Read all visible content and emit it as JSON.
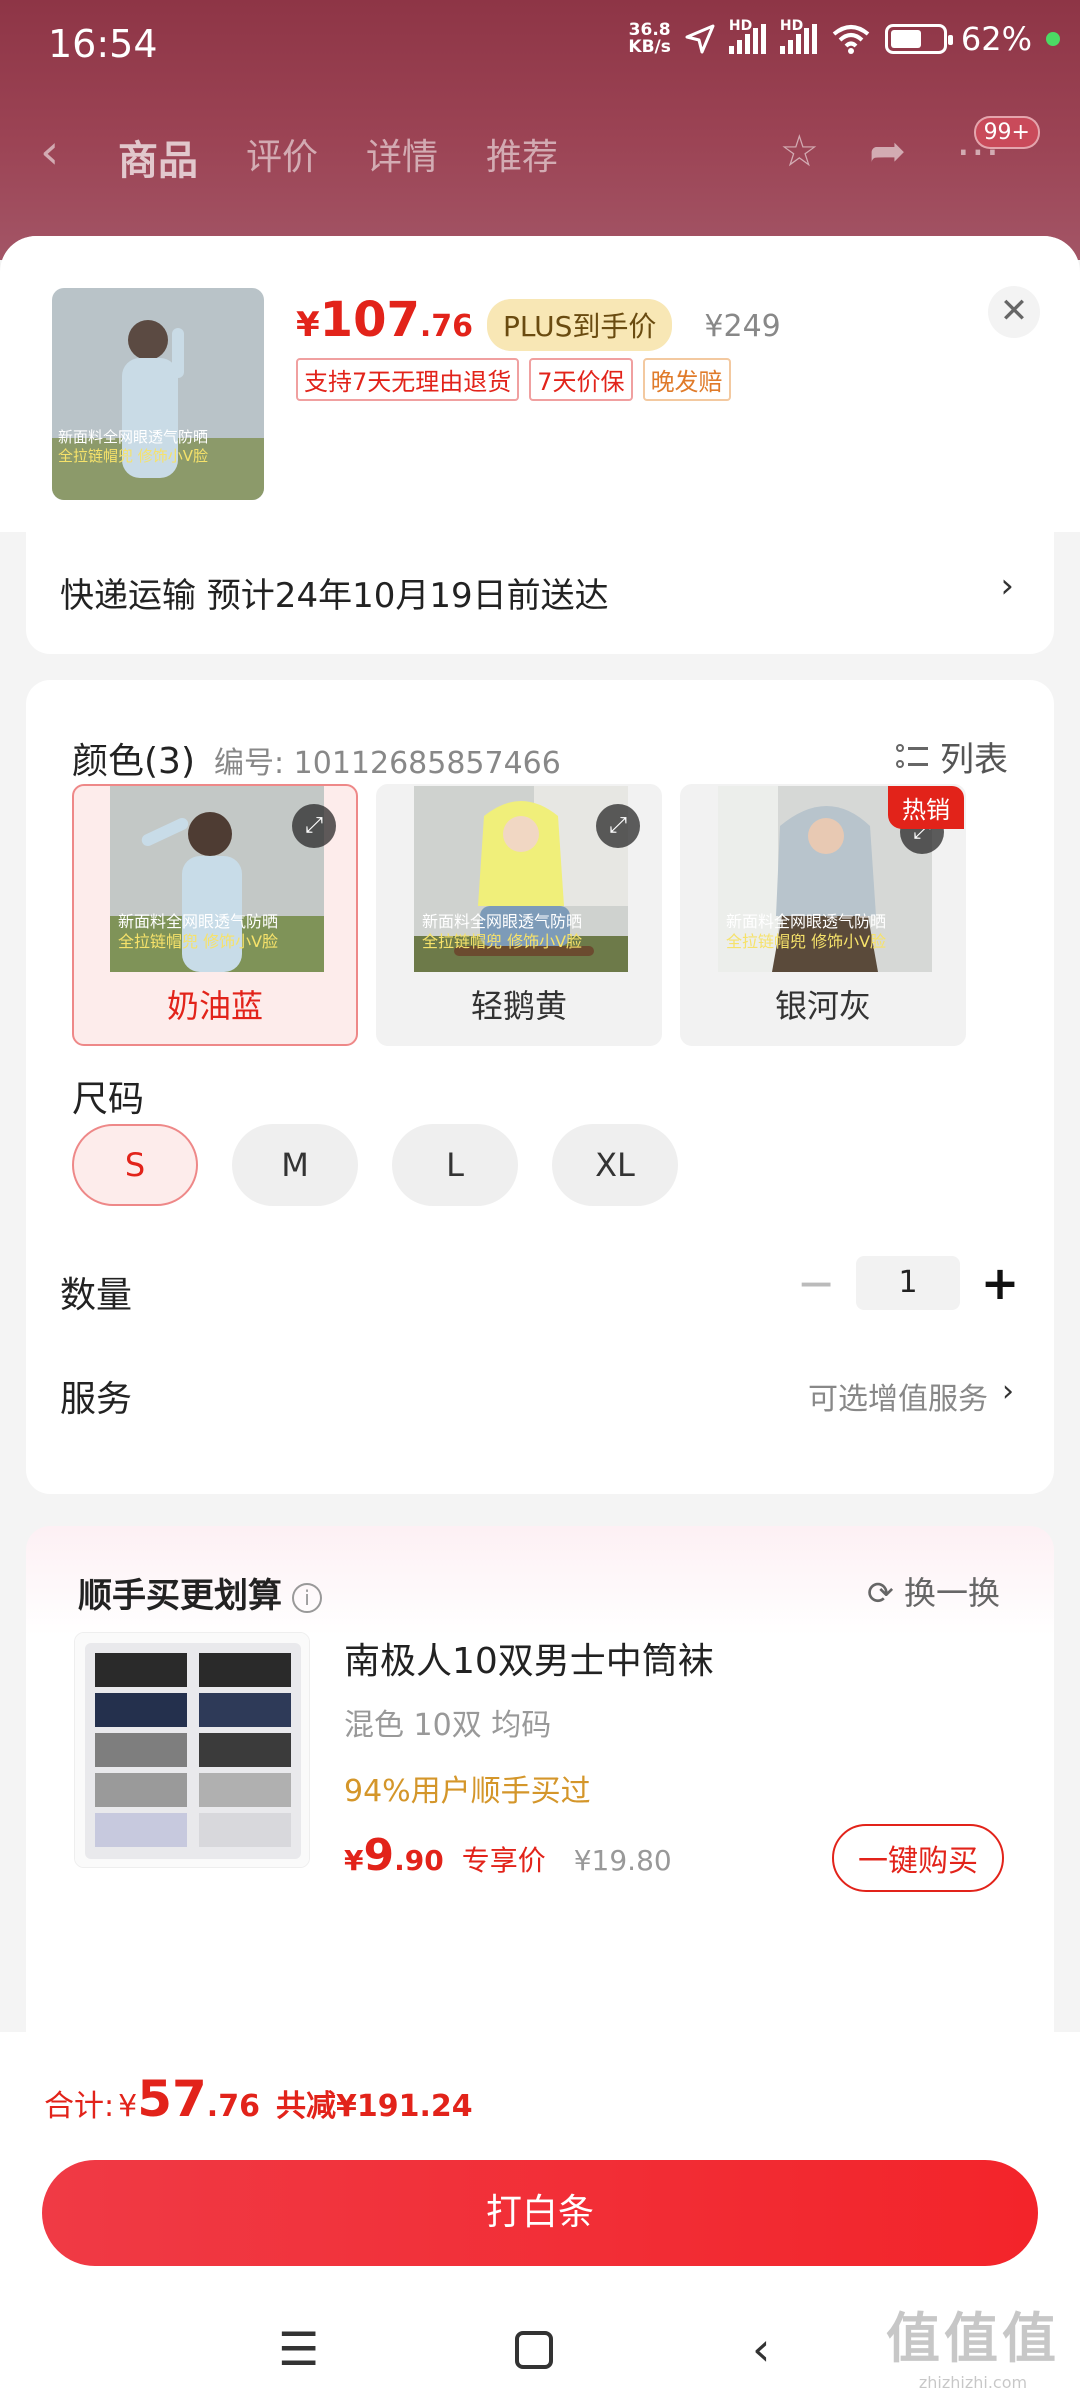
{
  "status": {
    "time": "16:54",
    "netspeed_value": "36.8",
    "netspeed_unit": "KB/s",
    "hd1": "HD",
    "hd2": "HD",
    "battery": "62%"
  },
  "bgnav": {
    "tabs": [
      "商品",
      "评价",
      "详情",
      "推荐"
    ],
    "badge": "99+"
  },
  "product": {
    "price_currency": "¥",
    "price_int": "107",
    "price_dec": ".76",
    "plus_tag": "PLUS到手价",
    "original_price": "¥249",
    "tags": [
      "支持7天无理由退货",
      "7天价保",
      "晚发赔"
    ],
    "thumb_caption_1": "新面料全网眼透气防晒",
    "thumb_caption_2": "全拉链帽兜 修饰小V脸"
  },
  "shipping": {
    "text": "快递运输 预计24年10月19日前送达"
  },
  "sku": {
    "color_title": "颜色(3)",
    "code": "编号: 10112685857466",
    "list_label": "列表",
    "colors": [
      {
        "name": "奶油蓝",
        "selected": true,
        "hot": ""
      },
      {
        "name": "轻鹅黄",
        "selected": false,
        "hot": ""
      },
      {
        "name": "银河灰",
        "selected": false,
        "hot": "热销"
      }
    ],
    "caption_1": "新面料全网眼透气防晒",
    "caption_2": "全拉链帽兜 修饰小V脸",
    "size_title": "尺码",
    "sizes": [
      "S",
      "M",
      "L",
      "XL"
    ],
    "selected_size": "S",
    "qty_label": "数量",
    "qty_value": "1",
    "service_label": "服务",
    "service_hint": "可选增值服务"
  },
  "bundle": {
    "title": "顺手买更划算",
    "refresh": "换一换",
    "name": "南极人10双男士中筒袜",
    "spec": "混色 10双   均码",
    "buyers": "94%用户顺手买过",
    "price_currency": "¥",
    "price_int": "9",
    "price_dec": ".90",
    "price_label": "专享价",
    "old_price": "¥19.80",
    "buy_label": "一键购买"
  },
  "footer": {
    "total_label": "合计:",
    "currency": "¥",
    "total_int": "57",
    "total_dec": ".76",
    "save_text": "共减¥191.24",
    "pay_label": "打白条"
  },
  "watermark": {
    "big": "值值值",
    "small": "zhizhizhi.com"
  },
  "colors": {
    "accent": "#e2231a",
    "plus_bg": "#f8e7b5",
    "header_bg": "#8e3546"
  }
}
